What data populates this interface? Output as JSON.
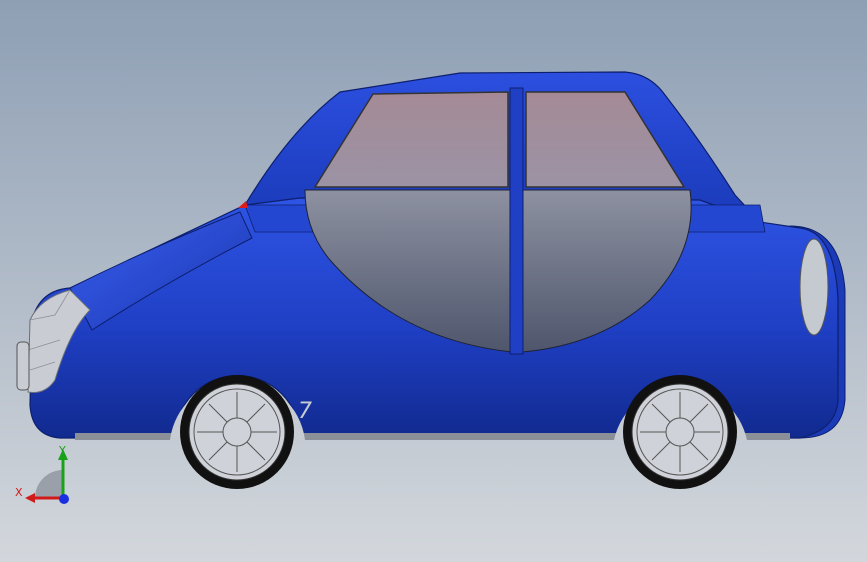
{
  "viewport": {
    "background_top": "#8e9fb4",
    "background_bottom": "#d3d7dc"
  },
  "model": {
    "body_color": "#1f3fc4",
    "glass_color": "#9e8a96",
    "door_lower_color": "#5c6378",
    "chrome_color": "#c9ccd2",
    "tire_color": "#111111",
    "floor_mark_label": "7"
  },
  "triad": {
    "x_label": "X",
    "y_label": "Y",
    "x_color": "#d11b1b",
    "y_color": "#1aa11a",
    "z_color": "#1b2fe0"
  }
}
